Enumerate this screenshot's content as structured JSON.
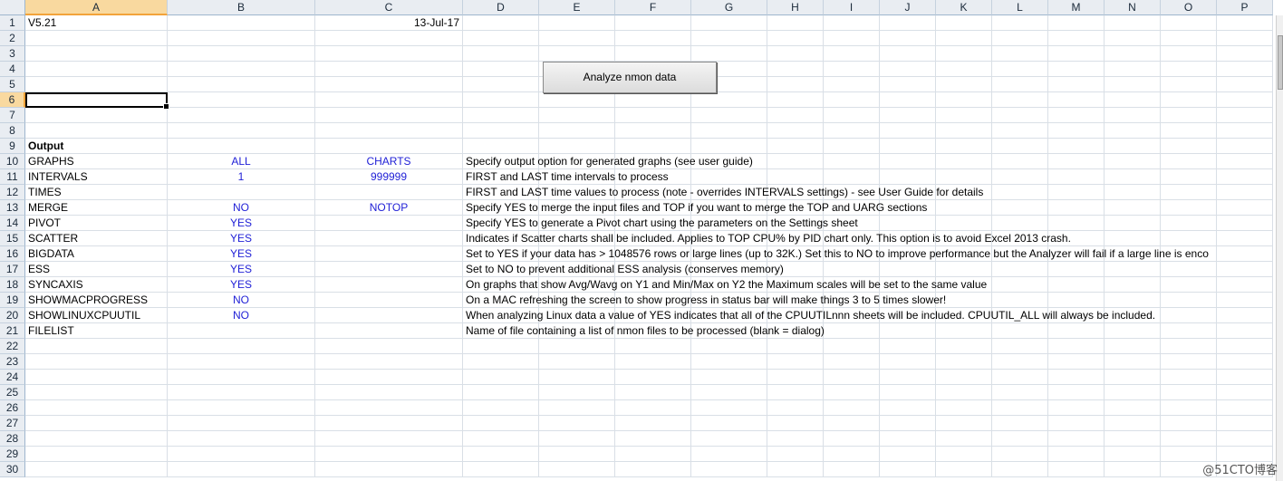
{
  "columns": [
    "A",
    "B",
    "C",
    "D",
    "E",
    "F",
    "G",
    "H",
    "I",
    "J",
    "K",
    "L",
    "M",
    "N",
    "O",
    "P"
  ],
  "selected_column": "A",
  "selected_row": "6",
  "rows": [
    {
      "n": "1",
      "a": "V5.21",
      "b": "",
      "c": "13-Jul-17",
      "d": ""
    },
    {
      "n": "2",
      "a": "",
      "b": "",
      "c": "",
      "d": ""
    },
    {
      "n": "3",
      "a": "",
      "b": "",
      "c": "",
      "d": ""
    },
    {
      "n": "4",
      "a": "",
      "b": "",
      "c": "",
      "d": ""
    },
    {
      "n": "5",
      "a": "",
      "b": "",
      "c": "",
      "d": ""
    },
    {
      "n": "6",
      "a": "",
      "b": "",
      "c": "",
      "d": ""
    },
    {
      "n": "7",
      "a": "",
      "b": "",
      "c": "",
      "d": ""
    },
    {
      "n": "8",
      "a": "",
      "b": "",
      "c": "",
      "d": ""
    },
    {
      "n": "9",
      "a": "Output",
      "b": "",
      "c": "",
      "d": ""
    },
    {
      "n": "10",
      "a": "GRAPHS",
      "b": "ALL",
      "c": "CHARTS",
      "d": "Specify output option for generated graphs (see user guide)"
    },
    {
      "n": "11",
      "a": "INTERVALS",
      "b": "1",
      "c": "999999",
      "d": "FIRST and LAST time intervals to process"
    },
    {
      "n": "12",
      "a": "TIMES",
      "b": "",
      "c": "",
      "d": "FIRST and LAST time values to process (note - overrides INTERVALS settings) - see User Guide for details"
    },
    {
      "n": "13",
      "a": "MERGE",
      "b": "NO",
      "c": "NOTOP",
      "d": "Specify YES to merge the input files and TOP if you want to merge the TOP and UARG sections"
    },
    {
      "n": "14",
      "a": "PIVOT",
      "b": "YES",
      "c": "",
      "d": "Specify YES to generate a Pivot chart using the parameters on the Settings sheet"
    },
    {
      "n": "15",
      "a": "SCATTER",
      "b": "YES",
      "c": "",
      "d": "Indicates if Scatter charts shall be included.  Applies to TOP CPU% by PID chart only.  This option is to avoid Excel 2013 crash."
    },
    {
      "n": "16",
      "a": "BIGDATA",
      "b": "YES",
      "c": "",
      "d": "Set to YES if your data has > 1048576 rows or large lines (up to 32K.)  Set this to NO to improve performance but the Analyzer will fail if a large line is enco"
    },
    {
      "n": "17",
      "a": "ESS",
      "b": "YES",
      "c": "",
      "d": "Set to NO to prevent additional ESS analysis (conserves memory)"
    },
    {
      "n": "18",
      "a": "SYNCAXIS",
      "b": "YES",
      "c": "",
      "d": "On graphs that show Avg/Wavg on Y1 and Min/Max on Y2 the Maximum scales will be set to the same value"
    },
    {
      "n": "19",
      "a": "SHOWMACPROGRESS",
      "b": "NO",
      "c": "",
      "d": "On a MAC refreshing the screen to show progress in status bar will make things 3 to 5 times slower!"
    },
    {
      "n": "20",
      "a": "SHOWLINUXCPUUTIL",
      "b": "NO",
      "c": "",
      "d": "When analyzing Linux data a value of YES indicates that all of the CPUUTILnnn sheets will be included.  CPUUTIL_ALL will always be included."
    },
    {
      "n": "21",
      "a": "FILELIST",
      "b": "",
      "c": "",
      "d": "Name of file containing a list of nmon files to be processed (blank = dialog)"
    },
    {
      "n": "22",
      "a": "",
      "b": "",
      "c": "",
      "d": ""
    },
    {
      "n": "23",
      "a": "",
      "b": "",
      "c": "",
      "d": ""
    },
    {
      "n": "24",
      "a": "",
      "b": "",
      "c": "",
      "d": ""
    },
    {
      "n": "25",
      "a": "",
      "b": "",
      "c": "",
      "d": ""
    },
    {
      "n": "26",
      "a": "",
      "b": "",
      "c": "",
      "d": ""
    },
    {
      "n": "27",
      "a": "",
      "b": "",
      "c": "",
      "d": ""
    },
    {
      "n": "28",
      "a": "",
      "b": "",
      "c": "",
      "d": ""
    },
    {
      "n": "29",
      "a": "",
      "b": "",
      "c": "",
      "d": ""
    },
    {
      "n": "30",
      "a": "",
      "b": "",
      "c": "",
      "d": ""
    }
  ],
  "button_label": "Analyze nmon data",
  "watermark": "@51CTO博客",
  "colors": {
    "blue_text": "#1f1fd6",
    "header_bg": "#e9edf2",
    "selection": "#f9d99f"
  }
}
